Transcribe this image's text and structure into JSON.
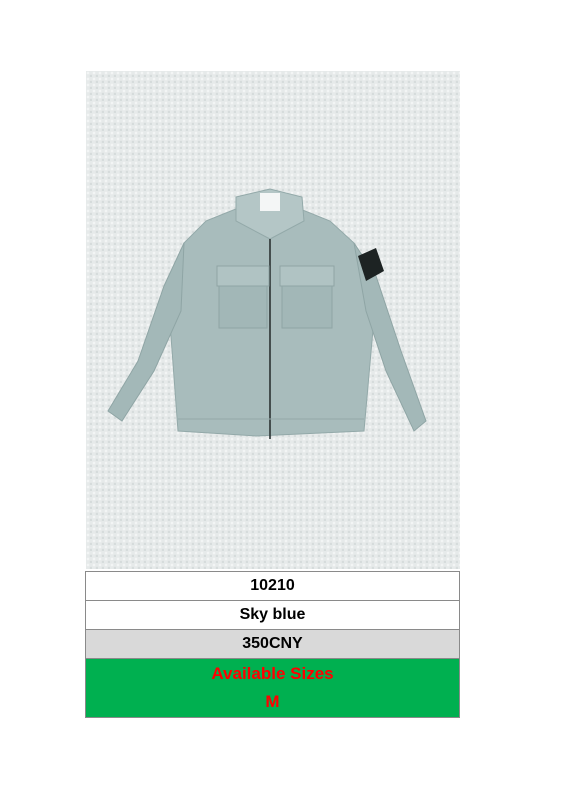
{
  "product": {
    "code": "10210",
    "color": "Sky blue",
    "price": "350CNY",
    "sizes_heading": "Available Sizes",
    "sizes": "M"
  },
  "colors": {
    "garment": "#a8bcbc",
    "background": "#e6eaea",
    "price_row": "#d9d9d9",
    "sizes_row": "#00b050",
    "sizes_text": "#ff0000"
  }
}
